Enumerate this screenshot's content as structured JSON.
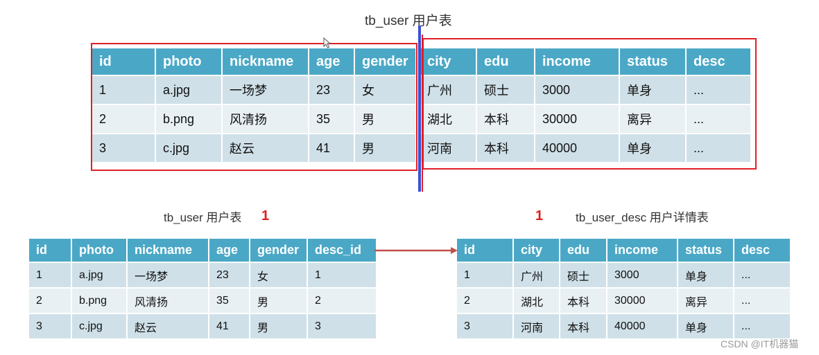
{
  "top": {
    "caption": "tb_user 用户表",
    "left_table": {
      "headers": [
        "id",
        "photo",
        "nickname",
        "age",
        "gender"
      ],
      "rows": [
        [
          "1",
          "a.jpg",
          "一场梦",
          "23",
          "女"
        ],
        [
          "2",
          "b.png",
          "风清扬",
          "35",
          "男"
        ],
        [
          "3",
          "c.jpg",
          "赵云",
          "41",
          "男"
        ]
      ]
    },
    "right_table": {
      "headers": [
        "city",
        "edu",
        "income",
        "status",
        "desc"
      ],
      "rows": [
        [
          "广州",
          "硕士",
          "3000",
          "单身",
          "..."
        ],
        [
          "湖北",
          "本科",
          "30000",
          "离异",
          "..."
        ],
        [
          "河南",
          "本科",
          "40000",
          "单身",
          "..."
        ]
      ]
    }
  },
  "bottom_left": {
    "caption": "tb_user 用户表",
    "cardinality": "1",
    "headers": [
      "id",
      "photo",
      "nickname",
      "age",
      "gender",
      "desc_id"
    ],
    "rows": [
      [
        "1",
        "a.jpg",
        "一场梦",
        "23",
        "女",
        "1"
      ],
      [
        "2",
        "b.png",
        "风清扬",
        "35",
        "男",
        "2"
      ],
      [
        "3",
        "c.jpg",
        "赵云",
        "41",
        "男",
        "3"
      ]
    ]
  },
  "bottom_right": {
    "caption": "tb_user_desc 用户详情表",
    "cardinality": "1",
    "headers": [
      "id",
      "city",
      "edu",
      "income",
      "status",
      "desc"
    ],
    "rows": [
      [
        "1",
        "广州",
        "硕士",
        "3000",
        "单身",
        "..."
      ],
      [
        "2",
        "湖北",
        "本科",
        "30000",
        "离异",
        "..."
      ],
      [
        "3",
        "河南",
        "本科",
        "40000",
        "单身",
        "..."
      ]
    ]
  },
  "watermark": "CSDN @IT机器猫",
  "colors": {
    "header_bg": "#4aa8c6",
    "row_odd": "#cfe0e8",
    "row_even": "#e8f0f4",
    "highlight_box": "#e01e25",
    "split_line": "#3e4fd0",
    "relation_arrow": "#c0504d"
  }
}
